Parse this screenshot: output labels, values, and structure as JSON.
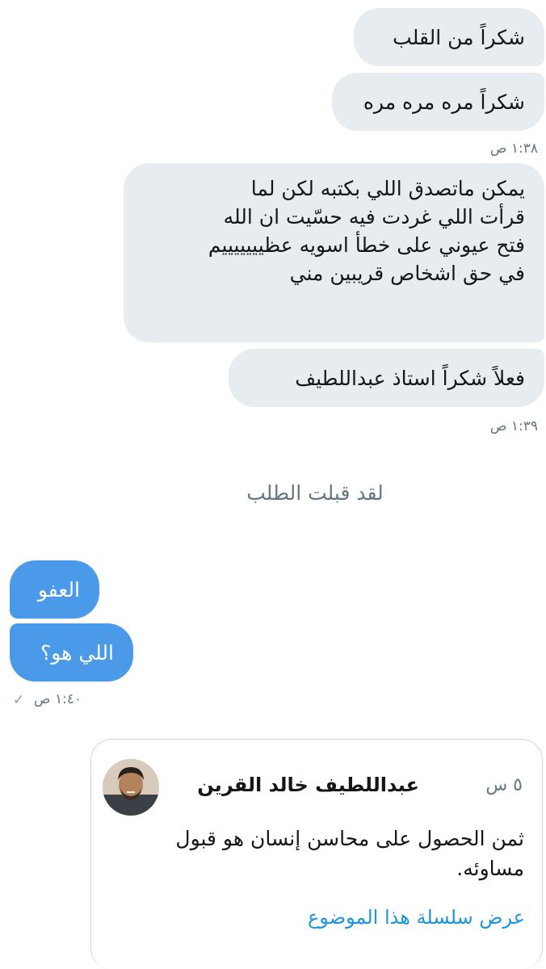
{
  "messages": [
    {
      "text": "شكراً من القلب"
    },
    {
      "text": "شكراً مره مره مره"
    },
    {
      "lines": [
        "يمكن ماتصدق اللي بكتبه لكن لما",
        "قرأت اللي غردت فيه حسّيت ان الله",
        "فتح عيوني على خطأ اسويه عظيييييييم",
        "في حق اشخاص قريبين مني"
      ]
    },
    {
      "text": "فعلاً شكراً استاذ عبداللطيف"
    },
    {
      "text": "العفو"
    },
    {
      "text": "اللي هو؟"
    }
  ],
  "timestamps": {
    "t1": "١:٣٨ ص",
    "t2": "١:٣٩ ص",
    "t3": "١:٤٠ ص"
  },
  "system_message": "لقد قبلت الطلب",
  "colors": {
    "incoming_bubble": "#e6ecf0",
    "outgoing_bubble": "#4a9ae9",
    "link": "#1b95e0"
  },
  "shared_tweet": {
    "author_name": "عبداللطيف خالد القرين",
    "age": "٥ س",
    "text": "ثمن الحصول على محاسن إنسان هو قبول مساوئه.",
    "view_thread_label": "عرض سلسلة هذا الموضوع"
  }
}
